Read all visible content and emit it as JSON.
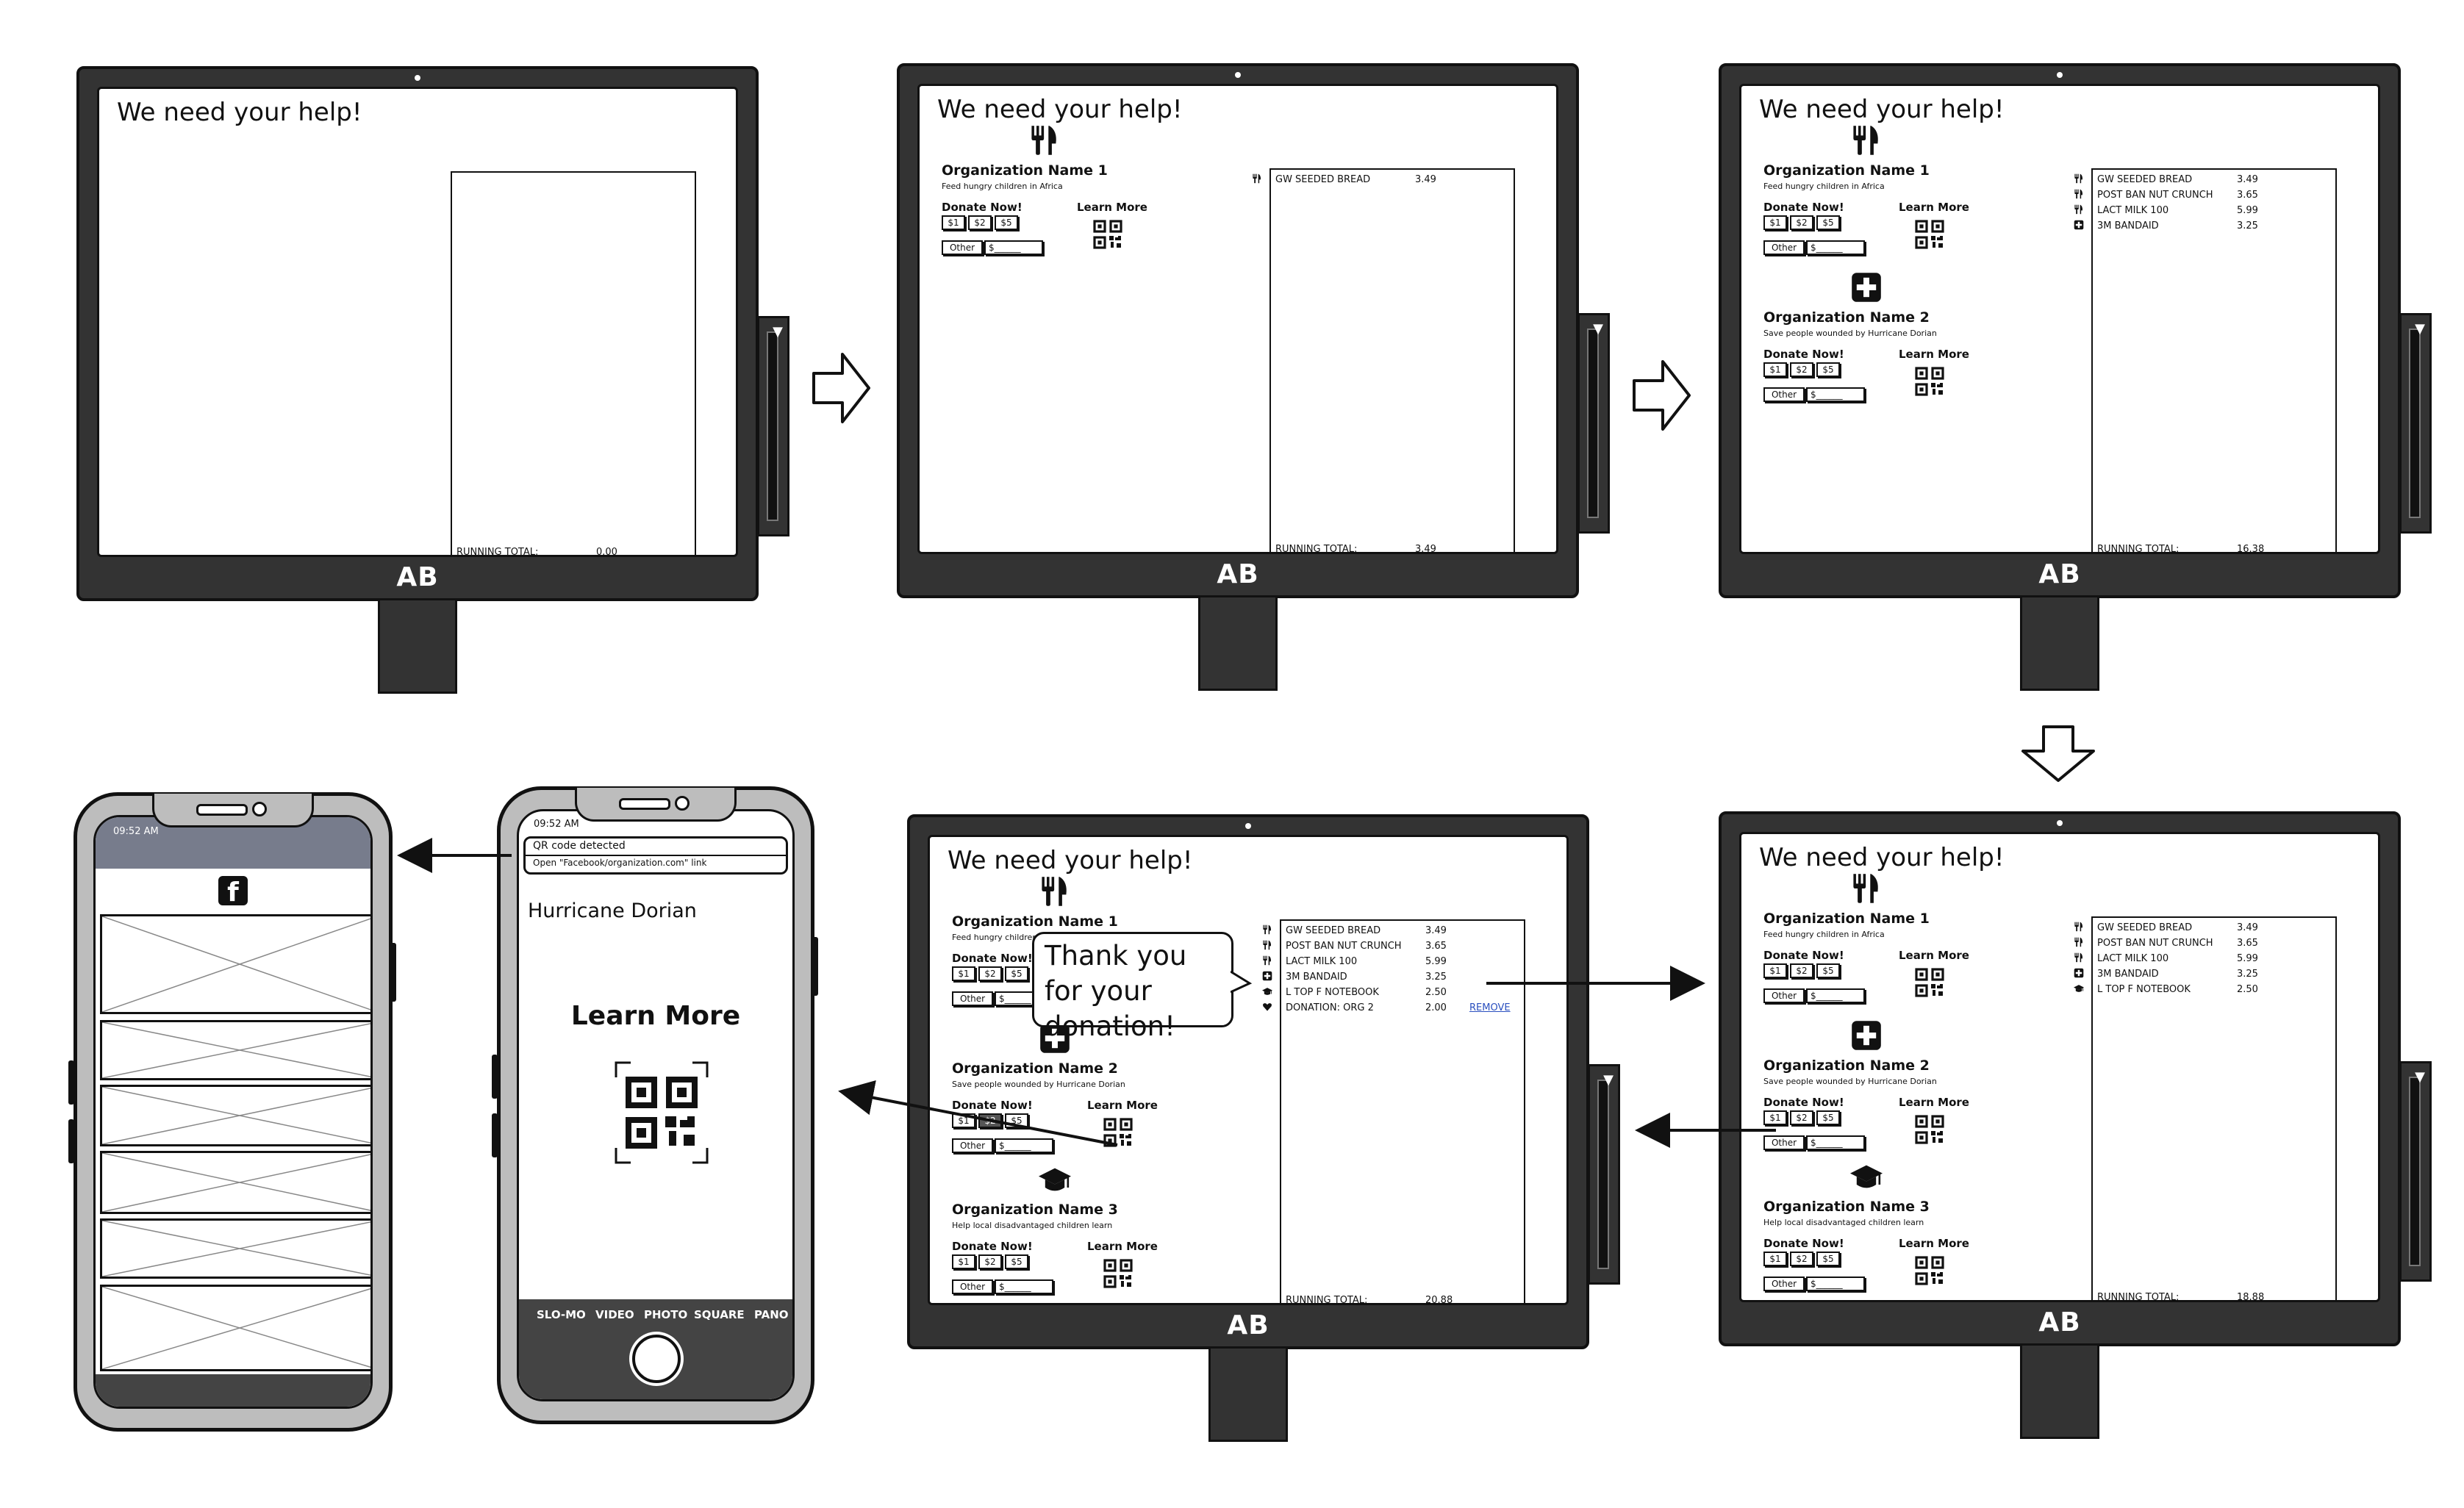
{
  "kiosk": {
    "headline": "We need your help!",
    "brand": "AB",
    "running_total_label": "RUNNING TOTAL:",
    "remove_label": "REMOVE",
    "donate_label": "Donate Now!",
    "learn_more_label": "Learn More",
    "amounts": [
      "$1",
      "$2",
      "$5"
    ],
    "other_label": "Other",
    "other_input": "$______",
    "thanks": "Thank you for your donation!"
  },
  "orgs": [
    {
      "name": "Organization Name 1",
      "desc": "Feed hungry children in Africa",
      "icon": "fork-knife-icon"
    },
    {
      "name": "Organization Name 2",
      "desc": "Save people wounded by Hurricane Dorian",
      "icon": "medical-cross-icon"
    },
    {
      "name": "Organization Name 3",
      "desc": "Help local disadvantaged children learn",
      "icon": "graduation-cap-icon"
    }
  ],
  "receipts": {
    "s1": {
      "total": "0.00",
      "items": []
    },
    "s2": {
      "total": "3.49",
      "items": [
        {
          "icon": "fork-knife-icon",
          "name": "GW SEEDED BREAD",
          "price": "3.49"
        }
      ]
    },
    "s3": {
      "total": "16.38",
      "items": [
        {
          "icon": "fork-knife-icon",
          "name": "GW SEEDED BREAD",
          "price": "3.49"
        },
        {
          "icon": "fork-knife-icon",
          "name": "POST BAN NUT CRUNCH",
          "price": "3.65"
        },
        {
          "icon": "fork-knife-icon",
          "name": "LACT MILK 100",
          "price": "5.99"
        },
        {
          "icon": "medical-cross-icon",
          "name": "3M BANDAID",
          "price": "3.25"
        }
      ]
    },
    "s4": {
      "total": "18.88",
      "items": [
        {
          "icon": "fork-knife-icon",
          "name": "GW SEEDED BREAD",
          "price": "3.49"
        },
        {
          "icon": "fork-knife-icon",
          "name": "POST BAN NUT CRUNCH",
          "price": "3.65"
        },
        {
          "icon": "fork-knife-icon",
          "name": "LACT MILK 100",
          "price": "5.99"
        },
        {
          "icon": "medical-cross-icon",
          "name": "3M BANDAID",
          "price": "3.25"
        },
        {
          "icon": "graduation-cap-icon",
          "name": "L TOP F NOTEBOOK",
          "price": "2.50"
        }
      ]
    },
    "s5": {
      "total": "20.88",
      "items": [
        {
          "icon": "fork-knife-icon",
          "name": "GW SEEDED BREAD",
          "price": "3.49"
        },
        {
          "icon": "fork-knife-icon",
          "name": "POST BAN NUT CRUNCH",
          "price": "3.65"
        },
        {
          "icon": "fork-knife-icon",
          "name": "LACT MILK 100",
          "price": "5.99"
        },
        {
          "icon": "medical-cross-icon",
          "name": "3M BANDAID",
          "price": "3.25"
        },
        {
          "icon": "graduation-cap-icon",
          "name": "L TOP F NOTEBOOK",
          "price": "2.50"
        },
        {
          "icon": "heart-icon",
          "name": "DONATION: ORG 2",
          "price": "2.00",
          "removable": true
        }
      ]
    }
  },
  "camera_phone": {
    "time": "09:52 AM",
    "notif_title": "QR code detected",
    "notif_body": "Open \"Facebook/organization.com\" link",
    "org": "Hurricane Dorian",
    "learn_more": "Learn More",
    "modes": [
      "SLO-MO",
      "VIDEO",
      "PHOTO",
      "SQUARE",
      "PANO"
    ]
  },
  "fb_phone": {
    "time": "09:52 AM",
    "app_icon": "facebook-icon",
    "letter": "f"
  }
}
